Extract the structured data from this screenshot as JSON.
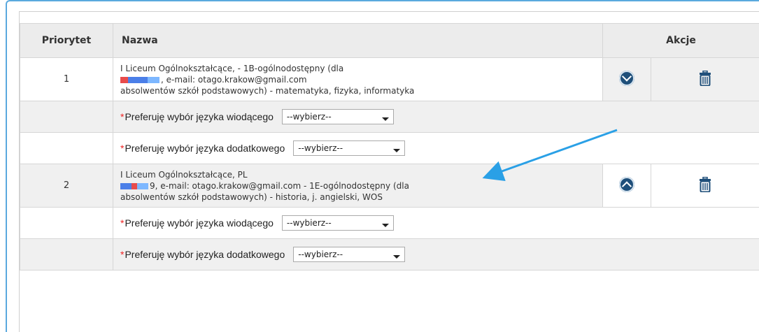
{
  "table": {
    "headers": {
      "priority": "Priorytet",
      "name": "Nazwa",
      "actions": "Akcje"
    },
    "rows": [
      {
        "priority": "1",
        "line1": "I Liceum Ogólnokształcące, - 1B-ogólnodostępny (dla",
        "line2": ", e-mail: otago.krakow@gmail.com",
        "line3": "absolwentów szkół podstawowych) - matematyka, fizyka, informatyka",
        "move_icon": "chevron-down-circle-icon",
        "delete_icon": "trash-icon",
        "prefs": [
          {
            "label": "Preferuję wybór języka wiodącego",
            "select_value": "--wybierz--"
          },
          {
            "label": "Preferuję wybór języka dodatkowego",
            "select_value": "--wybierz--"
          }
        ]
      },
      {
        "priority": "2",
        "line1": "I Liceum Ogólnokształcące, PL",
        "line2": "9, e-mail: otago.krakow@gmail.com - 1E-ogólnodostępny (dla",
        "line3": "absolwentów szkół podstawowych) - historia, j. angielski, WOS",
        "move_icon": "chevron-up-circle-icon",
        "delete_icon": "trash-icon",
        "prefs": [
          {
            "label": "Preferuję wybór języka wiodącego",
            "select_value": "--wybierz--"
          },
          {
            "label": "Preferuję wybór języka dodatkowego",
            "select_value": "--wybierz--"
          }
        ]
      }
    ]
  },
  "required_marker": "*",
  "colors": {
    "accent": "#5aa9de",
    "icon": "#1f4f7a",
    "required": "#e22222"
  }
}
